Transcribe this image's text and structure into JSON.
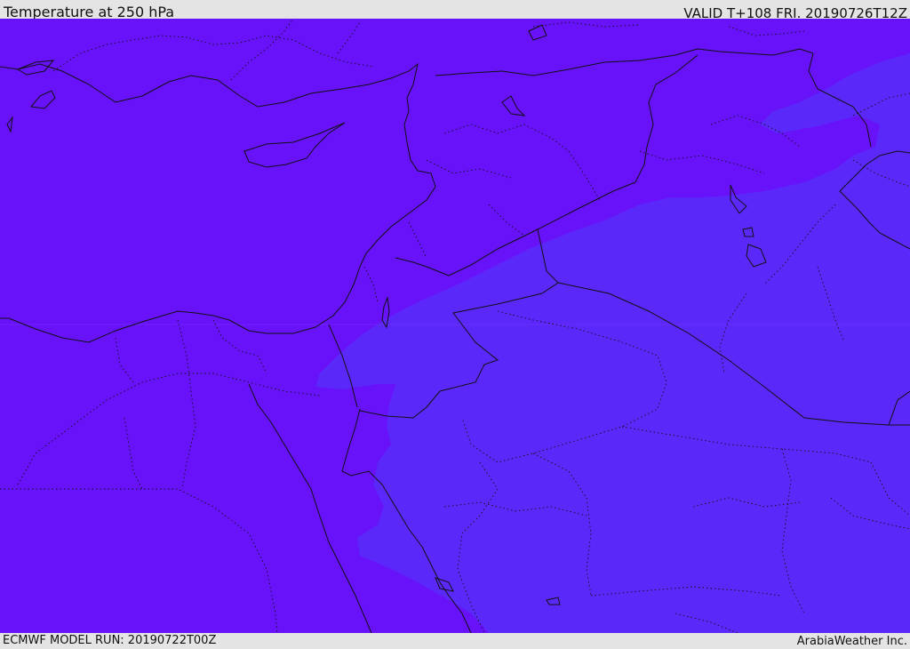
{
  "header": {
    "title": "Temperature at 250 hPa",
    "valid": "VALID T+108 FRI. 20190726T12Z"
  },
  "footer": {
    "model_run": "ECMWF MODEL RUN: 20190722T00Z",
    "credit": "ArabiaWeather Inc."
  },
  "map": {
    "colors": {
      "warmer_band": "#6812fa",
      "cooler_band": "#5b28fa",
      "lines": "#111111"
    }
  }
}
